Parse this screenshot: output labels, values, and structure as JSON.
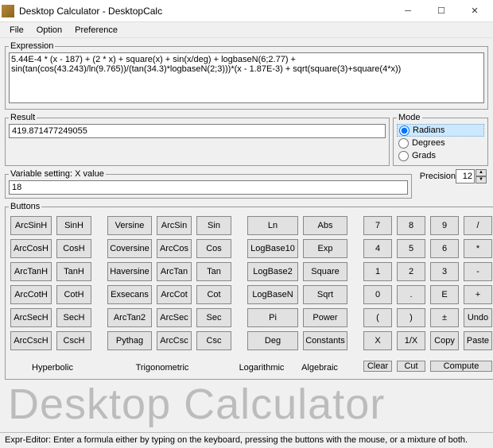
{
  "window": {
    "title": "Desktop Calculator - DesktopCalc"
  },
  "menu": {
    "file": "File",
    "option": "Option",
    "preference": "Preference"
  },
  "expression": {
    "legend": "Expression",
    "value": "5.44E-4 * (x - 187) + (2 * x) + square(x) + sin(x/deg) + logbaseN(6;2.77) + sin(tan(cos(43.243)/ln(9.765))/(tan(34.3)*logbaseN(2;3)))*(x - 1.87E-3) + sqrt(square(3)+square(4*x))"
  },
  "result": {
    "legend": "Result",
    "value": "419.871477249055"
  },
  "variable": {
    "legend": "Variable setting: X value",
    "value": "18"
  },
  "mode": {
    "legend": "Mode",
    "radians": "Radians",
    "degrees": "Degrees",
    "grads": "Grads"
  },
  "precision": {
    "label": "Precision",
    "value": "12"
  },
  "buttons": {
    "legend": "Buttons",
    "rows": [
      [
        "ArcSinH",
        "SinH",
        "",
        "Versine",
        "ArcSin",
        "Sin",
        "",
        "Ln",
        "Abs",
        "",
        "7",
        "8",
        "9",
        "/"
      ],
      [
        "ArcCosH",
        "CosH",
        "",
        "Coversine",
        "ArcCos",
        "Cos",
        "",
        "LogBase10",
        "Exp",
        "",
        "4",
        "5",
        "6",
        "*"
      ],
      [
        "ArcTanH",
        "TanH",
        "",
        "Haversine",
        "ArcTan",
        "Tan",
        "",
        "LogBase2",
        "Square",
        "",
        "1",
        "2",
        "3",
        "-"
      ],
      [
        "ArcCotH",
        "CotH",
        "",
        "Exsecans",
        "ArcCot",
        "Cot",
        "",
        "LogBaseN",
        "Sqrt",
        "",
        "0",
        ".",
        "E",
        "+"
      ],
      [
        "ArcSecH",
        "SecH",
        "",
        "ArcTan2",
        "ArcSec",
        "Sec",
        "",
        "Pi",
        "Power",
        "",
        "(",
        ")",
        "±",
        "Undo"
      ],
      [
        "ArcCscH",
        "CscH",
        "",
        "Pythag",
        "ArcCsc",
        "Csc",
        "",
        "Deg",
        "Constants",
        "",
        "X",
        "1/X",
        "Copy",
        "Paste"
      ]
    ],
    "categories": {
      "hyperbolic": "Hyperbolic",
      "trigonometric": "Trigonometric",
      "logarithmic": "Logarithmic",
      "algebraic": "Algebraic"
    },
    "actions": {
      "clear": "Clear",
      "cut": "Cut",
      "compute": "Compute"
    }
  },
  "bigtitle": "Desktop Calculator",
  "status": "Expr-Editor: Enter a formula either by typing on the keyboard, pressing the buttons with the mouse, or a mixture of both."
}
